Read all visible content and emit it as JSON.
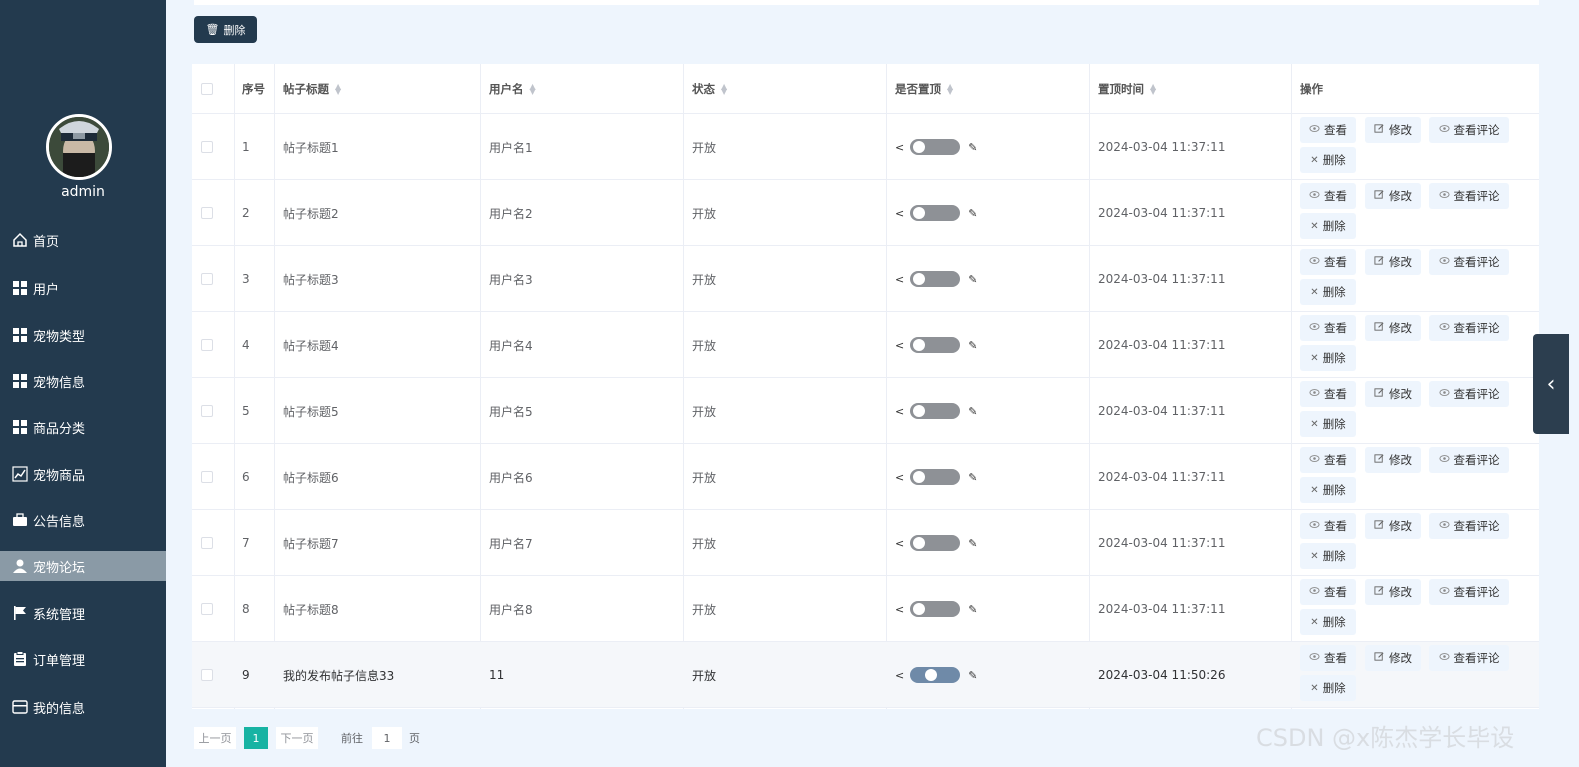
{
  "sidebar": {
    "username": "admin",
    "items": [
      {
        "label": "首页",
        "icon": "home-icon"
      },
      {
        "label": "用户",
        "icon": "grid-icon"
      },
      {
        "label": "宠物类型",
        "icon": "grid-icon"
      },
      {
        "label": "宠物信息",
        "icon": "grid-icon"
      },
      {
        "label": "商品分类",
        "icon": "grid-icon"
      },
      {
        "label": "宠物商品",
        "icon": "chart-icon"
      },
      {
        "label": "公告信息",
        "icon": "briefcase-icon"
      },
      {
        "label": "宠物论坛",
        "icon": "user-icon",
        "active": true
      },
      {
        "label": "系统管理",
        "icon": "flag-icon"
      },
      {
        "label": "订单管理",
        "icon": "clipboard-icon"
      },
      {
        "label": "我的信息",
        "icon": "card-icon"
      }
    ]
  },
  "toolbar": {
    "delete_label": "删除"
  },
  "table": {
    "headers": {
      "index": "序号",
      "title": "帖子标题",
      "username": "用户名",
      "status": "状态",
      "pinned": "是否置顶",
      "pin_time": "置顶时间",
      "actions": "操作"
    },
    "rows": [
      {
        "index": "1",
        "title": "帖子标题1",
        "username": "用户名1",
        "status": "开放",
        "pinned": false,
        "pin_time": "2024-03-04 11:37:11"
      },
      {
        "index": "2",
        "title": "帖子标题2",
        "username": "用户名2",
        "status": "开放",
        "pinned": false,
        "pin_time": "2024-03-04 11:37:11"
      },
      {
        "index": "3",
        "title": "帖子标题3",
        "username": "用户名3",
        "status": "开放",
        "pinned": false,
        "pin_time": "2024-03-04 11:37:11"
      },
      {
        "index": "4",
        "title": "帖子标题4",
        "username": "用户名4",
        "status": "开放",
        "pinned": false,
        "pin_time": "2024-03-04 11:37:11"
      },
      {
        "index": "5",
        "title": "帖子标题5",
        "username": "用户名5",
        "status": "开放",
        "pinned": false,
        "pin_time": "2024-03-04 11:37:11"
      },
      {
        "index": "6",
        "title": "帖子标题6",
        "username": "用户名6",
        "status": "开放",
        "pinned": false,
        "pin_time": "2024-03-04 11:37:11"
      },
      {
        "index": "7",
        "title": "帖子标题7",
        "username": "用户名7",
        "status": "开放",
        "pinned": false,
        "pin_time": "2024-03-04 11:37:11"
      },
      {
        "index": "8",
        "title": "帖子标题8",
        "username": "用户名8",
        "status": "开放",
        "pinned": false,
        "pin_time": "2024-03-04 11:37:11"
      },
      {
        "index": "9",
        "title": "我的发布帖子信息33",
        "username": "11",
        "status": "开放",
        "pinned": true,
        "pin_time": "2024-03-04 11:50:26"
      }
    ],
    "actions": {
      "view": "查看",
      "edit": "修改",
      "view_comments": "查看评论",
      "delete": "删除"
    }
  },
  "pagination": {
    "prev": "上一页",
    "current": "1",
    "next": "下一页",
    "goto_label": "前往",
    "goto_value": "1",
    "page_unit": "页"
  },
  "watermark": "CSDN @x陈杰学长毕设",
  "colors": {
    "sidebar_bg": "#233a4e",
    "active_item": "#8a9aa6",
    "page_current": "#17b3a3"
  }
}
